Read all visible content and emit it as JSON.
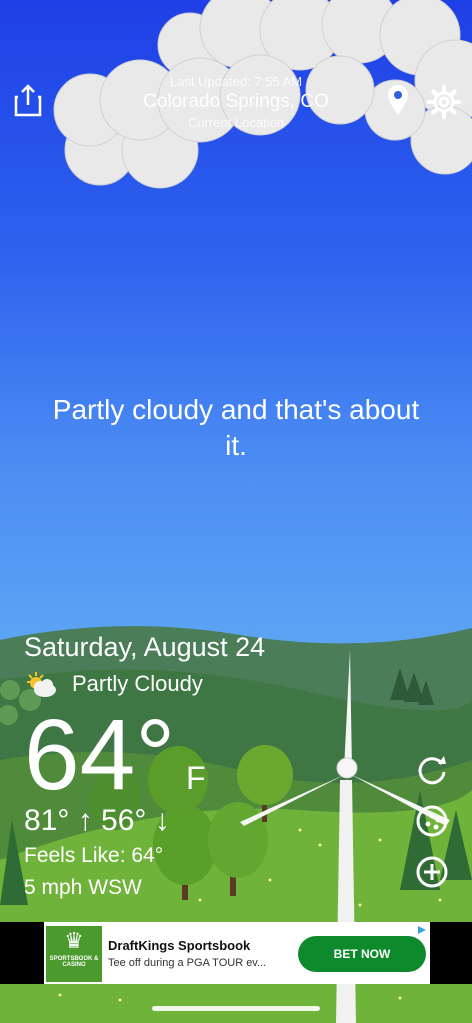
{
  "header": {
    "last_updated": "Last Updated: 7:55 AM",
    "city": "Colorado Springs, CO",
    "location_label": "Current Location"
  },
  "tagline": "Partly cloudy and that's about it.",
  "weather": {
    "date": "Saturday, August 24",
    "condition": "Partly Cloudy",
    "condition_icon": "partly-cloudy-icon",
    "temperature": "64°",
    "unit": "F",
    "high_low": "81° ↑ 56° ↓",
    "feels_like": "Feels Like: 64°",
    "wind": "5 mph WSW"
  },
  "icons": {
    "share": "share-icon",
    "location": "location-pin-icon",
    "settings": "gear-icon",
    "refresh": "refresh-icon",
    "radar": "radar-icon",
    "add": "add-icon"
  },
  "ad": {
    "logo_text": "SPORTSBOOK & CASINO",
    "title": "DraftKings Sportsbook",
    "subtitle": "Tee off during a PGA TOUR ev...",
    "cta": "BET NOW"
  },
  "colors": {
    "sky_top": "#1f3fe6",
    "sky_bottom": "#5ea7f1",
    "grass": "#6fb33a",
    "ad_button": "#0c8a2c"
  }
}
